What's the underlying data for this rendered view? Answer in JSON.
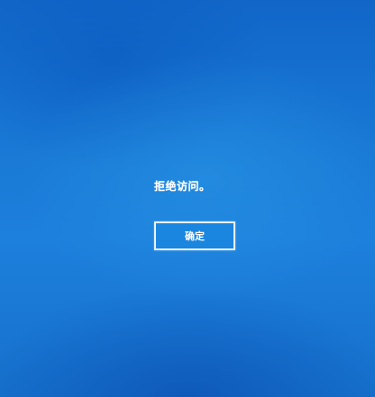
{
  "dialog": {
    "message": "拒绝访问。",
    "ok_label": "确定"
  },
  "colors": {
    "background": "#1a7ad6",
    "button_fill": "#1b86e0",
    "button_border": "#e6f2ff",
    "text": "#ffffff"
  }
}
